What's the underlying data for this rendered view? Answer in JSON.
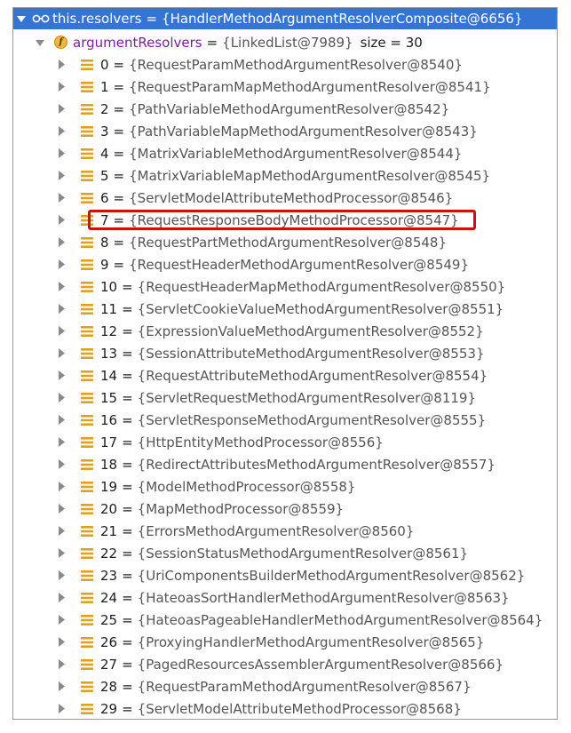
{
  "root": {
    "name": "this.resolvers",
    "value": "{HandlerMethodArgumentResolverComposite@6656}"
  },
  "field": {
    "name": "argumentResolvers",
    "value": "{LinkedList@7989}",
    "size": "size = 30"
  },
  "equals": "=",
  "highlighted_index": 7,
  "colors": {
    "selection": "#3574d4",
    "highlight_box": "#cc1010",
    "field_name": "#7a1fa2"
  },
  "items": [
    {
      "index": "0",
      "value": "{RequestParamMethodArgumentResolver@8540}"
    },
    {
      "index": "1",
      "value": "{RequestParamMapMethodArgumentResolver@8541}"
    },
    {
      "index": "2",
      "value": "{PathVariableMethodArgumentResolver@8542}"
    },
    {
      "index": "3",
      "value": "{PathVariableMapMethodArgumentResolver@8543}"
    },
    {
      "index": "4",
      "value": "{MatrixVariableMethodArgumentResolver@8544}"
    },
    {
      "index": "5",
      "value": "{MatrixVariableMapMethodArgumentResolver@8545}"
    },
    {
      "index": "6",
      "value": "{ServletModelAttributeMethodProcessor@8546}"
    },
    {
      "index": "7",
      "value": "{RequestResponseBodyMethodProcessor@8547}"
    },
    {
      "index": "8",
      "value": "{RequestPartMethodArgumentResolver@8548}"
    },
    {
      "index": "9",
      "value": "{RequestHeaderMethodArgumentResolver@8549}"
    },
    {
      "index": "10",
      "value": "{RequestHeaderMapMethodArgumentResolver@8550}"
    },
    {
      "index": "11",
      "value": "{ServletCookieValueMethodArgumentResolver@8551}"
    },
    {
      "index": "12",
      "value": "{ExpressionValueMethodArgumentResolver@8552}"
    },
    {
      "index": "13",
      "value": "{SessionAttributeMethodArgumentResolver@8553}"
    },
    {
      "index": "14",
      "value": "{RequestAttributeMethodArgumentResolver@8554}"
    },
    {
      "index": "15",
      "value": "{ServletRequestMethodArgumentResolver@8119}"
    },
    {
      "index": "16",
      "value": "{ServletResponseMethodArgumentResolver@8555}"
    },
    {
      "index": "17",
      "value": "{HttpEntityMethodProcessor@8556}"
    },
    {
      "index": "18",
      "value": "{RedirectAttributesMethodArgumentResolver@8557}"
    },
    {
      "index": "19",
      "value": "{ModelMethodProcessor@8558}"
    },
    {
      "index": "20",
      "value": "{MapMethodProcessor@8559}"
    },
    {
      "index": "21",
      "value": "{ErrorsMethodArgumentResolver@8560}"
    },
    {
      "index": "22",
      "value": "{SessionStatusMethodArgumentResolver@8561}"
    },
    {
      "index": "23",
      "value": "{UriComponentsBuilderMethodArgumentResolver@8562}"
    },
    {
      "index": "24",
      "value": "{HateoasSortHandlerMethodArgumentResolver@8563}"
    },
    {
      "index": "25",
      "value": "{HateoasPageableHandlerMethodArgumentResolver@8564}"
    },
    {
      "index": "26",
      "value": "{ProxyingHandlerMethodArgumentResolver@8565}"
    },
    {
      "index": "27",
      "value": "{PagedResourcesAssemblerArgumentResolver@8566}"
    },
    {
      "index": "28",
      "value": "{RequestParamMethodArgumentResolver@8567}"
    },
    {
      "index": "29",
      "value": "{ServletModelAttributeMethodProcessor@8568}"
    }
  ]
}
